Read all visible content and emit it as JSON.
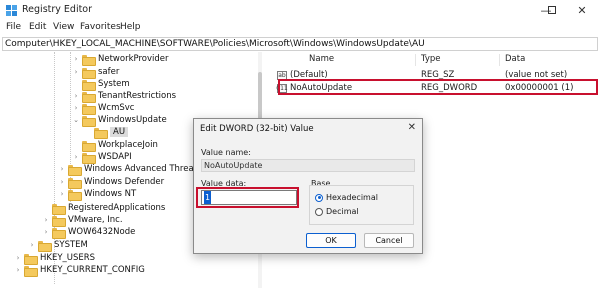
{
  "window": {
    "title": "Registry Editor",
    "min_glyph": "—",
    "max_glyph": "☐",
    "close_glyph": "✕"
  },
  "menu": [
    "File",
    "Edit",
    "View",
    "Favorites",
    "Help"
  ],
  "address": "Computer\\HKEY_LOCAL_MACHINE\\SOFTWARE\\Policies\\Microsoft\\Windows\\WindowsUpdate\\AU",
  "tree": [
    {
      "label": "NetworkProvider",
      "expander": "›"
    },
    {
      "label": "safer",
      "expander": "›"
    },
    {
      "label": "System",
      "expander": ""
    },
    {
      "label": "TenantRestrictions",
      "expander": "›"
    },
    {
      "label": "WcmSvc",
      "expander": "›"
    },
    {
      "label": "WindowsUpdate",
      "expander": "⌄"
    },
    {
      "label": "AU",
      "expander": "",
      "selected": true
    },
    {
      "label": "WorkplaceJoin",
      "expander": ""
    },
    {
      "label": "WSDAPI",
      "expander": "›"
    },
    {
      "label": "Windows Advanced Threat Pr",
      "expander": "›"
    },
    {
      "label": "Windows Defender",
      "expander": "›"
    },
    {
      "label": "Windows NT",
      "expander": "›"
    },
    {
      "label": "RegisteredApplications",
      "expander": ""
    },
    {
      "label": "VMware, Inc.",
      "expander": "›"
    },
    {
      "label": "WOW6432Node",
      "expander": "›"
    },
    {
      "label": "SYSTEM",
      "expander": "›"
    },
    {
      "label": "HKEY_USERS",
      "expander": "›"
    },
    {
      "label": "HKEY_CURRENT_CONFIG",
      "expander": "›"
    }
  ],
  "columns": {
    "name": "Name",
    "type": "Type",
    "data": "Data"
  },
  "values": [
    {
      "icon": "ab",
      "name": "(Default)",
      "type": "REG_SZ",
      "data": "(value not set)"
    },
    {
      "icon": "011",
      "name": "NoAutoUpdate",
      "type": "REG_DWORD",
      "data": "0x00000001 (1)"
    }
  ],
  "dialog": {
    "title": "Edit DWORD (32-bit) Value",
    "close_glyph": "✕",
    "value_name_label": "Value name:",
    "value_name": "NoAutoUpdate",
    "value_data_label": "Value data:",
    "value_data": "1",
    "base_label": "Base",
    "hex_label": "Hexadecimal",
    "dec_label": "Decimal",
    "base_selected": "Hexadecimal",
    "ok_label": "OK",
    "cancel_label": "Cancel"
  },
  "colors": {
    "highlight": "#c8102e",
    "accent": "#0b5fd0",
    "folder": "#f4c95d"
  }
}
